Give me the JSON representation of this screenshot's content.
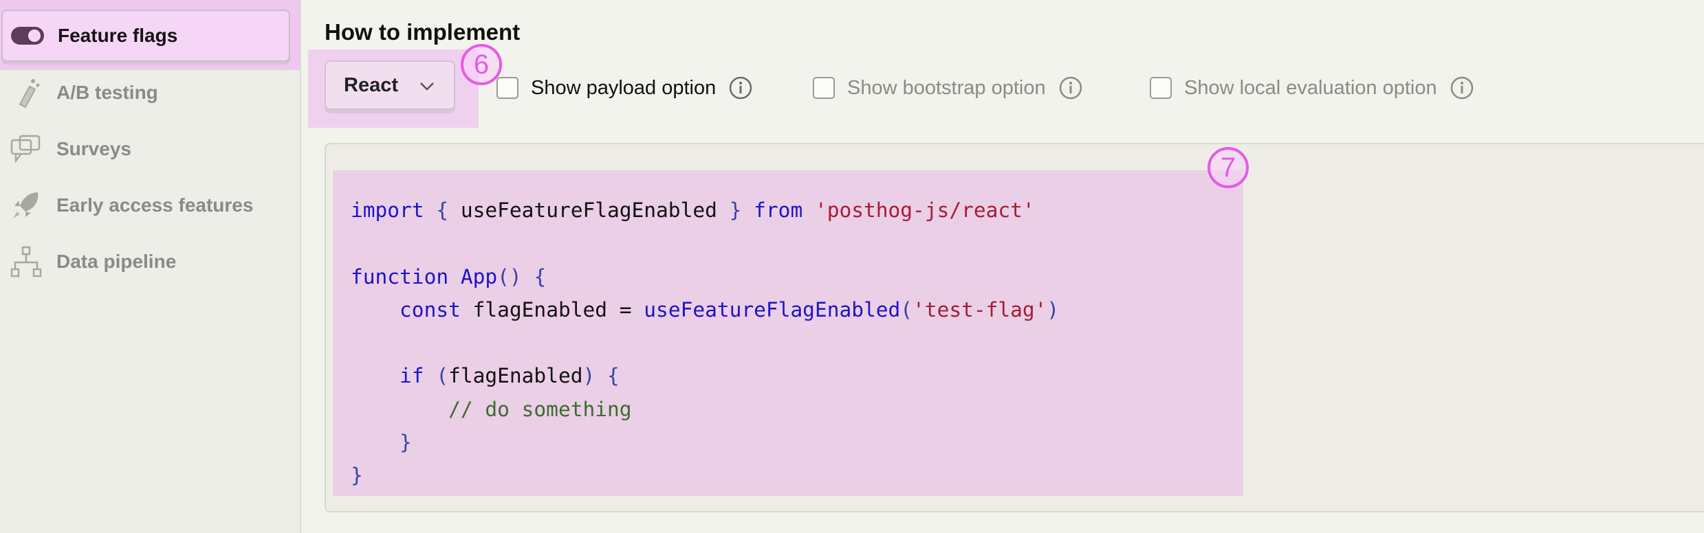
{
  "sidebar": {
    "items": [
      {
        "label": "Feature flags",
        "icon": "toggle-icon",
        "active": true
      },
      {
        "label": "A/B testing",
        "icon": "flask-icon"
      },
      {
        "label": "Surveys",
        "icon": "chat-bubbles-icon"
      },
      {
        "label": "Early access features",
        "icon": "rocket-icon"
      },
      {
        "label": "Data pipeline",
        "icon": "pipeline-icon"
      }
    ]
  },
  "main": {
    "title": "How to implement",
    "framework_select": {
      "value": "React"
    },
    "markers": {
      "six": "6",
      "seven": "7"
    },
    "options": [
      {
        "label": "Show payload option",
        "checked": false
      },
      {
        "label": "Show bootstrap option",
        "checked": false
      },
      {
        "label": "Show local evaluation option",
        "checked": false
      }
    ]
  },
  "code": {
    "line1": {
      "import": "import",
      "open": "{",
      "name": "useFeatureFlagEnabled",
      "close": "}",
      "from": "from",
      "module": "'posthog-js/react'"
    },
    "line3": {
      "function": "function",
      "name": "App",
      "parens": "()",
      "open": "{"
    },
    "line4": {
      "const": "const",
      "var": "flagEnabled",
      "eq": "=",
      "call": "useFeatureFlagEnabled",
      "open": "(",
      "arg": "'test-flag'",
      "close": ")"
    },
    "line6": {
      "if": "if",
      "open": "(",
      "var": "flagEnabled",
      "close": ")",
      "brace": "{"
    },
    "line7": {
      "comment": "// do something"
    },
    "line8": {
      "brace": "}"
    },
    "line9": {
      "brace": "}"
    }
  },
  "colors": {
    "highlight": "#efd0ef",
    "marker": "#e75ae6",
    "keyword": "#1d13c7",
    "string": "#a41d34",
    "comment": "#3d6b2e"
  }
}
